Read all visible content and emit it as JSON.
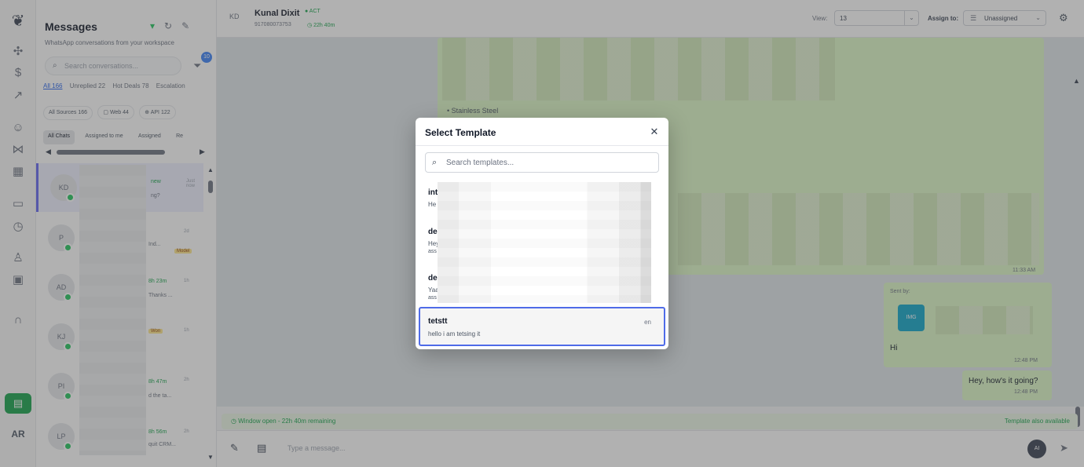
{
  "rail": {
    "icons": [
      "logo-icon",
      "puzzle-icon",
      "dollar-icon",
      "trend-icon",
      "users-icon",
      "workflow-icon",
      "grid-icon",
      "monitor-icon",
      "clock-icon",
      "person-icon",
      "lock-icon",
      "headset-icon",
      "inbox-icon"
    ],
    "avatar_initials": "AR"
  },
  "panel": {
    "title": "Messages",
    "subtitle": "WhatsApp conversations from your workspace",
    "search_placeholder": "Search conversations...",
    "filter_count": "10",
    "stat_tabs": [
      "All 166",
      "Unreplied 22",
      "Hot Deals 78",
      "Escalation"
    ],
    "chips": [
      "All Sources 166",
      "Web 44",
      "API 122"
    ],
    "sub_tabs": [
      "All Chats",
      "Assigned to me",
      "Assigned",
      "Re"
    ],
    "conversations": [
      {
        "initials": "KD",
        "tag": "new",
        "snippet": "ng?",
        "time": "Just now"
      },
      {
        "initials": "P",
        "tag": "",
        "snippet": "Ind...",
        "time": "2d",
        "badge": "Model"
      },
      {
        "initials": "AD",
        "tag": "8h 23m",
        "snippet": "Thanks ...",
        "time": "1h"
      },
      {
        "initials": "KJ",
        "tag": "",
        "snippet": "",
        "time": "1h",
        "badge": "Won"
      },
      {
        "initials": "PI",
        "tag": "8h 47m",
        "snippet": "d the ta...",
        "time": "2h"
      },
      {
        "initials": "LP",
        "tag": "8h 56m",
        "snippet": "quit CRM...",
        "time": "2h"
      }
    ]
  },
  "chat": {
    "header": {
      "avatar": "KD",
      "name": "Kunal Dixit",
      "status": "ACT",
      "phone": "917080073753",
      "timer": "22h 40m",
      "view_label": "View:",
      "view_value": "13",
      "assign_label": "Assign to:",
      "assign_value": "Unassigned"
    },
    "messages": {
      "caption": "Stainless Steel",
      "time1": "11:33 AM",
      "sent_by": "Sent by:",
      "img_label": "IMG",
      "hi": "Hi",
      "time2": "12:48 PM",
      "hey": "Hey, how's it going?",
      "time3": "12:48 PM"
    },
    "window_bar": {
      "left": "Window open - 22h 40m remaining",
      "right": "Template also available"
    },
    "composer_placeholder": "Type a message...",
    "ai_label": "AI"
  },
  "modal": {
    "title": "Select Template",
    "search_placeholder": "Search templates...",
    "templates": [
      {
        "name": "int",
        "lang": "n",
        "body": "He",
        "body2": ""
      },
      {
        "name": "de",
        "lang": "n",
        "body": "Hey",
        "body2": "ass"
      },
      {
        "name": "de",
        "lang": "n",
        "body": "Yaa",
        "body2": "ass"
      },
      {
        "name": "tetstt",
        "lang": "en",
        "body": "hello i am tetsing it",
        "body2": ""
      }
    ]
  }
}
